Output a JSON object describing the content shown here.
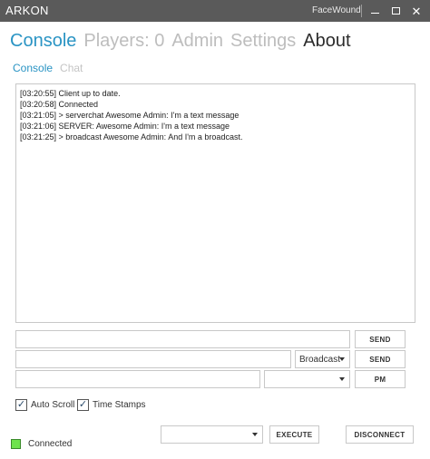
{
  "window": {
    "title": "ARKON",
    "user": "FaceWound",
    "minimize_icon": "minimize-icon",
    "maximize_icon": "maximize-icon",
    "close_glyph": "✕"
  },
  "main_tabs": [
    {
      "label": "Console"
    },
    {
      "label": "Players: 0"
    },
    {
      "label": "Admin"
    },
    {
      "label": "Settings"
    },
    {
      "label": "About"
    }
  ],
  "sub_tabs": [
    {
      "label": "Console"
    },
    {
      "label": "Chat"
    }
  ],
  "console": {
    "lines": [
      "[03:20:55] Client up to date.",
      "[03:20:58] Connected",
      "[03:21:05] > serverchat Awesome Admin: I'm a text message",
      "[03:21:06] SERVER: Awesome Admin: I'm a text message",
      "[03:21:25] > broadcast Awesome Admin: And I'm a broadcast."
    ]
  },
  "command_row": {
    "input_value": "",
    "send_label": "SEND"
  },
  "broadcast_row": {
    "input_value": "",
    "mode_selected": "Broadcast",
    "send_label": "SEND"
  },
  "pm_row": {
    "input_value": "",
    "player_selected": "",
    "pm_label": "PM"
  },
  "options": {
    "auto_scroll_label": "Auto Scroll",
    "auto_scroll_checked": true,
    "time_stamps_label": "Time Stamps",
    "time_stamps_checked": true,
    "check_glyph": "✓"
  },
  "actions": {
    "execute_selected": "",
    "execute_label": "EXECUTE",
    "disconnect_label": "DISCONNECT"
  },
  "status": {
    "label": "Connected",
    "color": "#6ee34c"
  },
  "colors": {
    "accent": "#2a94c4",
    "titlebar": "#5a5a5a"
  }
}
